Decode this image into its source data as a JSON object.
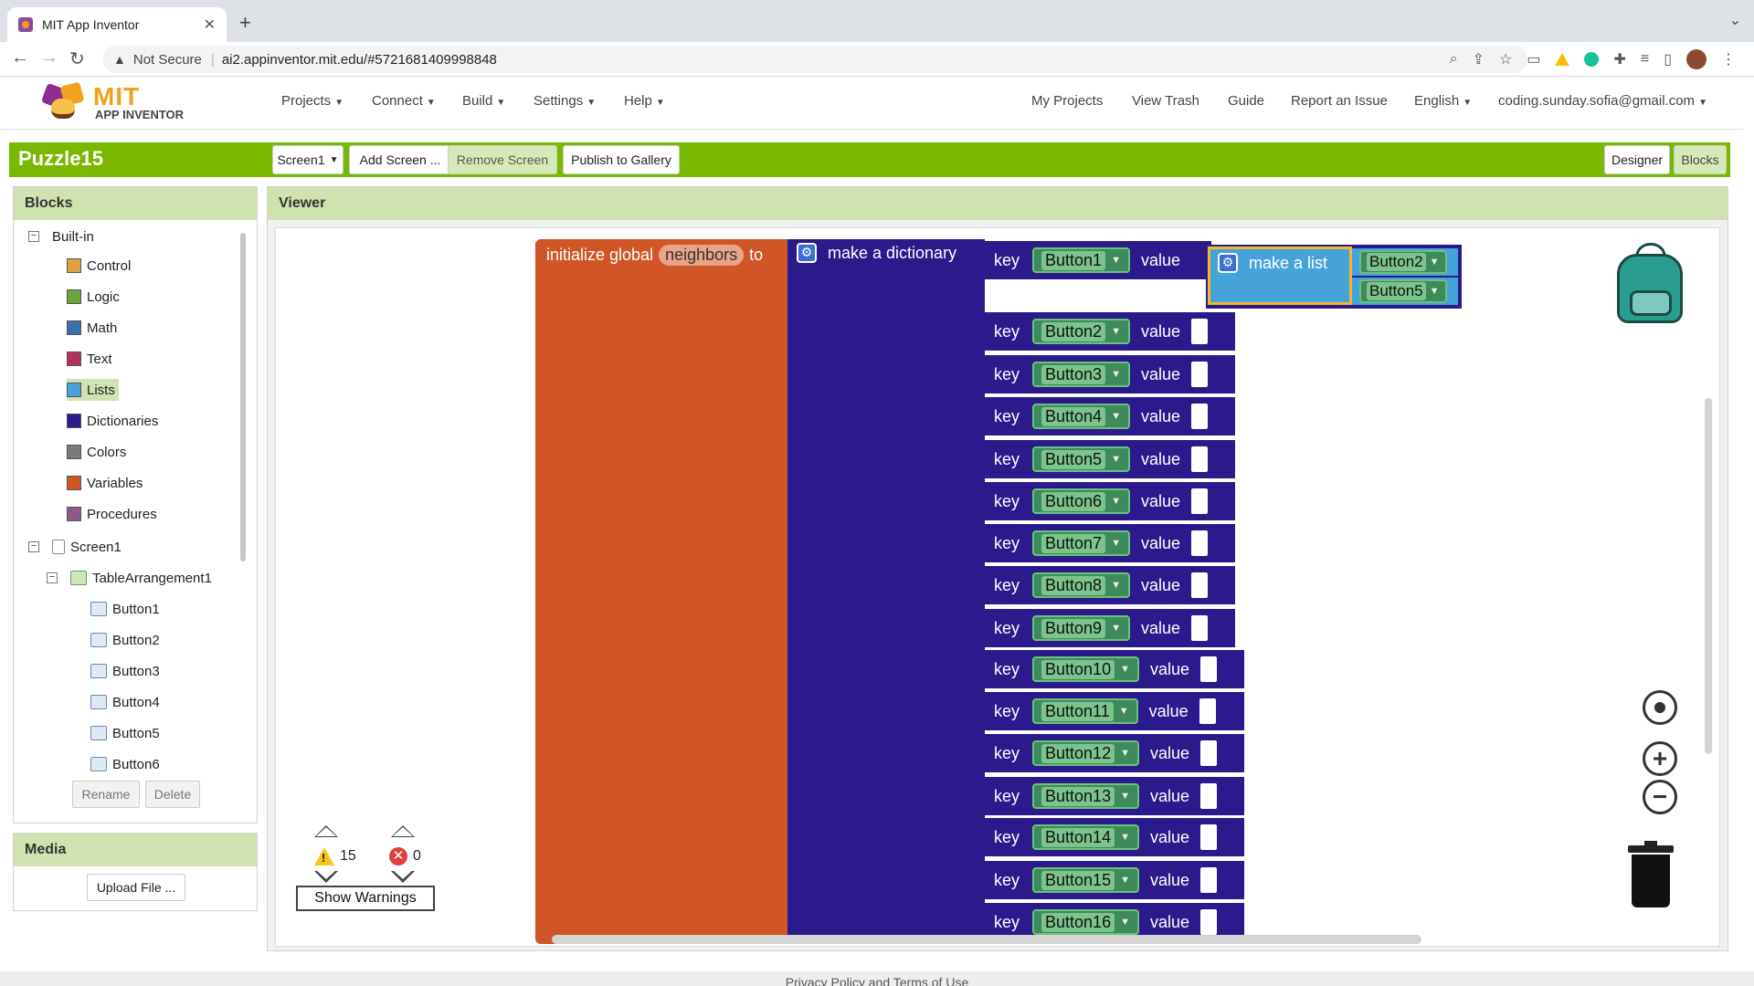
{
  "browser": {
    "tab_title": "MIT App Inventor",
    "security_label": "Not Secure",
    "url": "ai2.appinventor.mit.edu/#5721681409998848"
  },
  "header": {
    "logo_mit": "MIT",
    "logo_sub": "APP INVENTOR",
    "menus": [
      "Projects",
      "Connect",
      "Build",
      "Settings",
      "Help"
    ],
    "links": [
      "My Projects",
      "View Trash",
      "Guide",
      "Report an Issue"
    ],
    "language": "English",
    "account": "coding.sunday.sofia@gmail.com"
  },
  "project": {
    "name": "Puzzle15",
    "screen_select": "Screen1",
    "add_screen": "Add Screen ...",
    "remove_screen": "Remove Screen",
    "publish": "Publish to Gallery",
    "designer": "Designer",
    "blocks": "Blocks"
  },
  "blocks_panel": {
    "title": "Blocks",
    "builtin_label": "Built-in",
    "builtin": [
      {
        "label": "Control",
        "color": "#d9a441"
      },
      {
        "label": "Logic",
        "color": "#6ba53a"
      },
      {
        "label": "Math",
        "color": "#3b6fb0"
      },
      {
        "label": "Text",
        "color": "#b0325e"
      },
      {
        "label": "Lists",
        "color": "#45a3d9"
      },
      {
        "label": "Dictionaries",
        "color": "#2a1a8c"
      },
      {
        "label": "Colors",
        "color": "#7a7a7a"
      },
      {
        "label": "Variables",
        "color": "#d05628"
      },
      {
        "label": "Procedures",
        "color": "#8a5a8a"
      }
    ],
    "selected": "Lists",
    "screen": "Screen1",
    "arrangement": "TableArrangement1",
    "components": [
      "Button1",
      "Button2",
      "Button3",
      "Button4",
      "Button5",
      "Button6"
    ],
    "rename": "Rename",
    "delete": "Delete"
  },
  "media_panel": {
    "title": "Media",
    "upload": "Upload File ..."
  },
  "viewer": {
    "title": "Viewer",
    "init_prefix": "initialize global",
    "var_name": "neighbors",
    "init_suffix": "to",
    "dict_label": "make a dictionary",
    "key_label": "key",
    "value_label": "value",
    "list_label": "make a list",
    "list_items": [
      "Button2",
      "Button5"
    ],
    "keys": [
      "Button1",
      "Button2",
      "Button3",
      "Button4",
      "Button5",
      "Button6",
      "Button7",
      "Button8",
      "Button9",
      "Button10",
      "Button11",
      "Button12",
      "Button13",
      "Button14",
      "Button15",
      "Button16"
    ]
  },
  "warnings": {
    "warning_count": "15",
    "error_count": "0",
    "show_warnings": "Show Warnings"
  },
  "footer": "Privacy Policy and Terms of Use"
}
